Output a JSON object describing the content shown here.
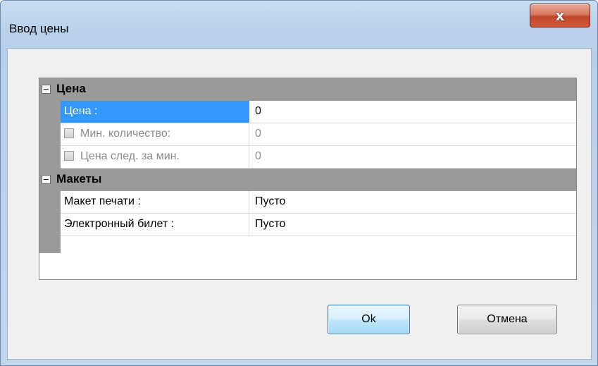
{
  "window": {
    "title": "Ввод цены",
    "close_label": "x"
  },
  "categories": [
    {
      "label": "Цена",
      "properties": [
        {
          "name": "Цена :",
          "value": "0",
          "selected": true,
          "checkbox": false,
          "enabled": true
        },
        {
          "name": "Мин. количество:",
          "value": "0",
          "selected": false,
          "checkbox": true,
          "checked": false,
          "enabled": false
        },
        {
          "name": "Цена след. за мин.",
          "value": "0",
          "selected": false,
          "checkbox": true,
          "checked": false,
          "enabled": false
        }
      ]
    },
    {
      "label": "Макеты",
      "properties": [
        {
          "name": "Макет печати :",
          "value": "Пусто",
          "selected": false,
          "checkbox": false,
          "enabled": true
        },
        {
          "name": "Электронный билет :",
          "value": "Пусто",
          "selected": false,
          "checkbox": false,
          "enabled": true
        }
      ]
    }
  ],
  "buttons": {
    "ok_label": "Ok",
    "cancel_label": "Отмена"
  },
  "colors": {
    "selection": "#3399ff",
    "category_band": "#9a9a9a",
    "disabled_text": "#8a8a8a"
  }
}
